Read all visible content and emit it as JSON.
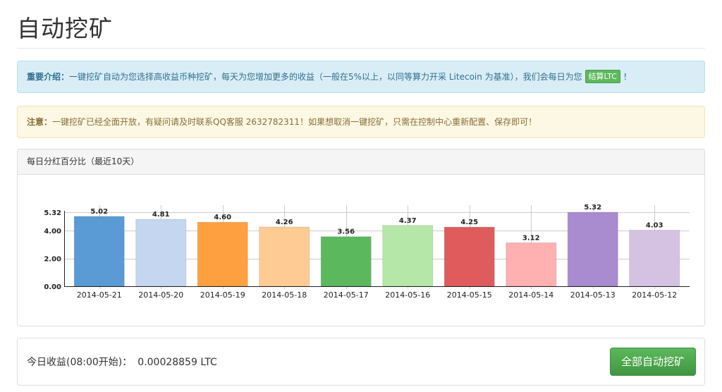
{
  "page": {
    "title": "自动挖矿"
  },
  "info_alert": {
    "label": "重要介绍：",
    "text": "一键挖矿自动为您选择高收益币种挖矿，每天为您增加更多的收益（一般在5%以上，以同等算力开采 Litecoin 为基准），我们会每日为您",
    "badge": "结算LTC",
    "suffix": "！"
  },
  "warning_alert": {
    "label": "注意：",
    "text": "一键挖矿已经全面开放，有疑问请及时联系QQ客服 2632782311！如果想取消一键挖矿，只需在控制中心重新配置、保存即可！"
  },
  "chart_panel": {
    "heading": "每日分红百分比（最近10天）"
  },
  "chart_data": {
    "type": "bar",
    "title": "",
    "xlabel": "",
    "ylabel": "",
    "categories": [
      "2014-05-21",
      "2014-05-20",
      "2014-05-19",
      "2014-05-18",
      "2014-05-17",
      "2014-05-16",
      "2014-05-15",
      "2014-05-14",
      "2014-05-13",
      "2014-05-12"
    ],
    "values": [
      5.02,
      4.81,
      4.6,
      4.26,
      3.56,
      4.37,
      4.25,
      3.12,
      5.32,
      4.03
    ],
    "value_labels": [
      "5.02",
      "4.81",
      "4.60",
      "4.26",
      "3.56",
      "4.37",
      "4.25",
      "3.12",
      "5.32",
      "4.03"
    ],
    "colors": [
      "#5b9bd5",
      "#c5d7f0",
      "#ffa040",
      "#ffcb94",
      "#5cb85c",
      "#b5e8a8",
      "#e05c5c",
      "#ffb0b0",
      "#a98bcf",
      "#d5c2e2"
    ],
    "y_ticks": [
      "0.00",
      "2.00",
      "4.00",
      "5.32"
    ],
    "y_tick_values": [
      0,
      2,
      4,
      5.32
    ],
    "ylim": [
      0,
      5.32
    ],
    "grid": true
  },
  "footer": {
    "income_label": "今日收益(08:00开始)：",
    "income_value": "0.00028859 LTC",
    "button_label": "全部自动挖矿"
  }
}
